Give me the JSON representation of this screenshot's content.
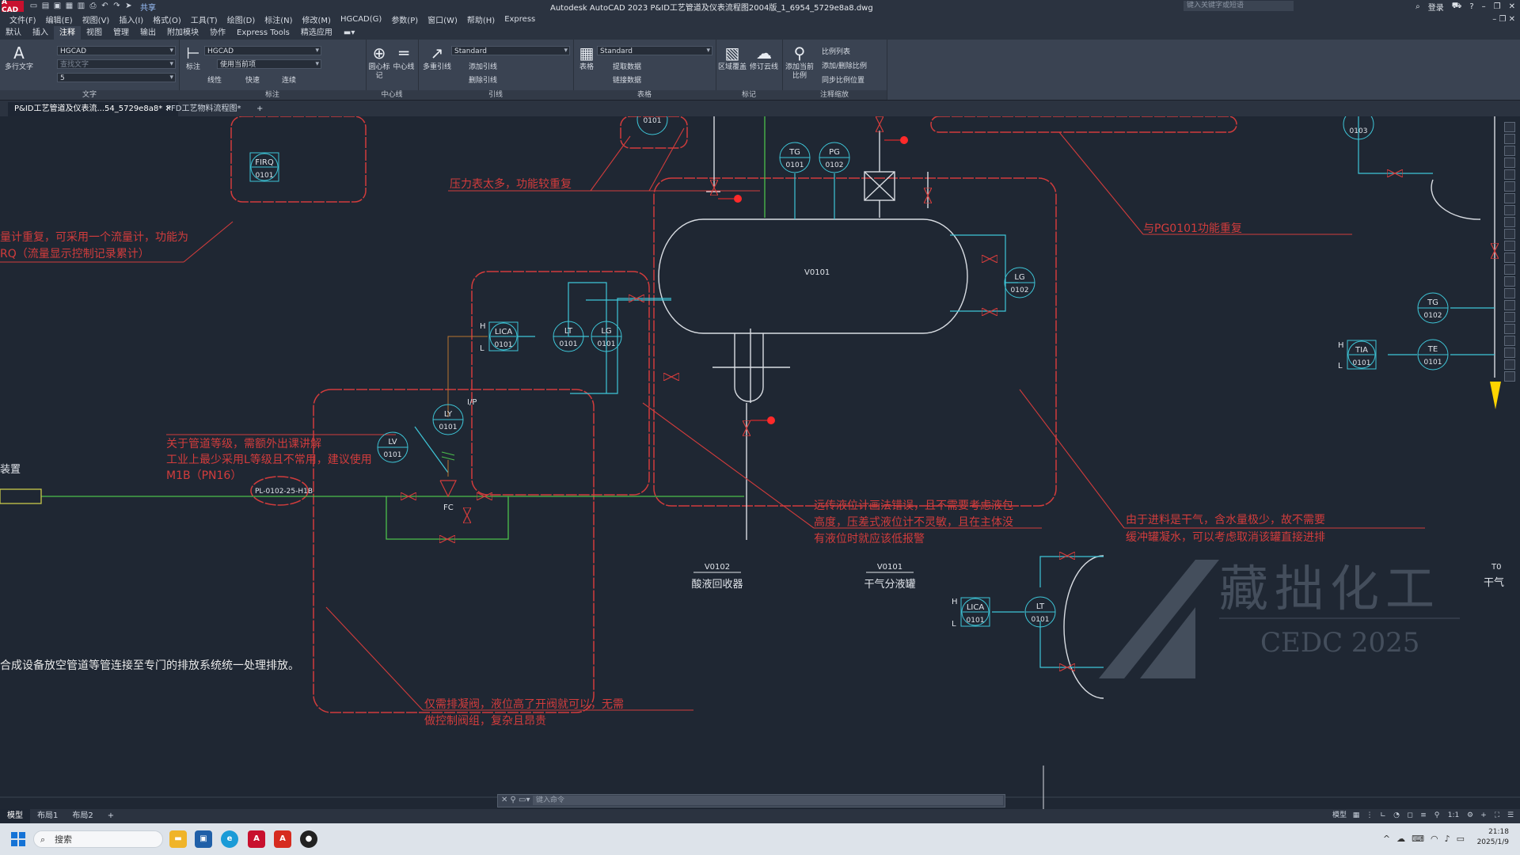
{
  "window": {
    "app_logo": "A CAD",
    "title": "Autodesk AutoCAD 2023    P&ID工艺管道及仪表流程图2004版_1_6954_5729e8a8.dwg",
    "share": "共享",
    "search_placeholder": "键入关键字或短语",
    "login": "登录"
  },
  "menu": [
    "文件(F)",
    "编辑(E)",
    "视图(V)",
    "插入(I)",
    "格式(O)",
    "工具(T)",
    "绘图(D)",
    "标注(N)",
    "修改(M)",
    "HGCAD(G)",
    "参数(P)",
    "窗口(W)",
    "帮助(H)",
    "Express"
  ],
  "ribbon_tabs": [
    "默认",
    "插入",
    "注释",
    "视图",
    "管理",
    "输出",
    "附加模块",
    "协作",
    "Express Tools",
    "精选应用"
  ],
  "active_ribbon_tab": "注释",
  "ribbon": {
    "text_group": {
      "label": "文字",
      "multiline_text": "多行文字",
      "style": "HGCAD",
      "find_placeholder": "查找文字",
      "height": "5"
    },
    "dim_group": {
      "label": "标注",
      "dim": "标注",
      "dimstyle": "HGCAD",
      "layer": "使用当前项",
      "linear": "线性",
      "quick": "快速",
      "continue": "连续"
    },
    "centerline_group": {
      "label": "中心线",
      "center_mark": "圆心标记",
      "centerline": "中心线"
    },
    "leader_group": {
      "label": "引线",
      "multileader": "多重引线",
      "style": "Standard",
      "add_leader": "添加引线",
      "remove_leader": "删除引线"
    },
    "table_group": {
      "label": "表格",
      "table": "表格",
      "style": "Standard",
      "extract": "提取数据",
      "link": "链接数据"
    },
    "markup_group": {
      "label": "标记",
      "wipeout": "区域覆盖",
      "revcloud": "修订云线"
    },
    "scale_group": {
      "label": "注释缩放",
      "add_current": "添加当前比例",
      "scale_list": "比例列表",
      "add_delete": "添加/删除比例",
      "sync": "同步比例位置"
    }
  },
  "doc_tabs": [
    "P&ID工艺管道及仪表流...54_5729e8a8*",
    "PFD工艺物料流程图*"
  ],
  "drawing": {
    "instruments": [
      {
        "code": "FIRQ",
        "num": "0101"
      },
      {
        "code": "TG",
        "num": "0101"
      },
      {
        "code": "PG",
        "num": "0102"
      },
      {
        "code": "LG",
        "num": "0102"
      },
      {
        "code": "LICA",
        "num": "0101"
      },
      {
        "code": "LT",
        "num": "0101"
      },
      {
        "code": "LG",
        "num": "0101"
      },
      {
        "code": "LY",
        "num": "0101"
      },
      {
        "code": "LV",
        "num": "0101"
      },
      {
        "code": "TG",
        "num": "0102"
      },
      {
        "code": "TIA",
        "num": "0101"
      },
      {
        "code": "TE",
        "num": "0101"
      },
      {
        "code": "LICA",
        "num": "0101"
      },
      {
        "code": "LT",
        "num": "0101"
      }
    ],
    "vessel_tag": "V0101",
    "pipe_tag": "PL-0102-25-H1B",
    "labels": {
      "h": "H",
      "l": "L",
      "ip": "I/P",
      "fc": "FC",
      "top_bubble": "0101",
      "right_top": "0103",
      "left_edge": "装置",
      "far_right_tag": "T0",
      "far_right_text": "干气"
    },
    "equipment": [
      {
        "tag": "V0102",
        "name": "酸液回收器"
      },
      {
        "tag": "V0101",
        "name": "干气分液罐"
      }
    ],
    "notes": {
      "pressure": "压力表太多，功能较重复",
      "flow1": "量计重复，可采用一个流量计，功能为",
      "flow2": "RQ（流量显示控制记录累计）",
      "pg": "与PG0101功能重复",
      "grade1": "关于管道等级，需额外出课讲解",
      "grade2": "工业上最少采用L等级且不常用，建议使用",
      "grade3": "M1B（PN16）",
      "remote1": "远传液位计画法错误，且不需要考虑液包",
      "remote2": "高度，压差式液位计不灵敏，且在主体没",
      "remote3": "有液位时就应该低报警",
      "dry1": "由于进料是干气，含水量极少，故不需要",
      "dry2": "缓冲罐凝水，可以考虑取消该罐直接进排",
      "vent": "合成设备放空管道等管连接至专门的排放系统统一处理排放。",
      "drain1": "仅需排凝阀，液位高了开阀就可以，无需",
      "drain2": "做控制阀组，复杂且昂贵"
    },
    "watermark": {
      "cn": "藏拙化工",
      "en": "CEDC 2025"
    }
  },
  "command_placeholder": "键入命令",
  "layout_tabs": [
    "模型",
    "布局1",
    "布局2"
  ],
  "status": {
    "model": "模型",
    "scale": "1:1"
  },
  "taskbar": {
    "search": "搜索",
    "time": "21:18",
    "date": "2025/1/9"
  },
  "colors": {
    "red": "#d23c3c",
    "cyan": "#3ec6d8",
    "green": "#4cbf4c",
    "white": "#e8e8e8"
  }
}
